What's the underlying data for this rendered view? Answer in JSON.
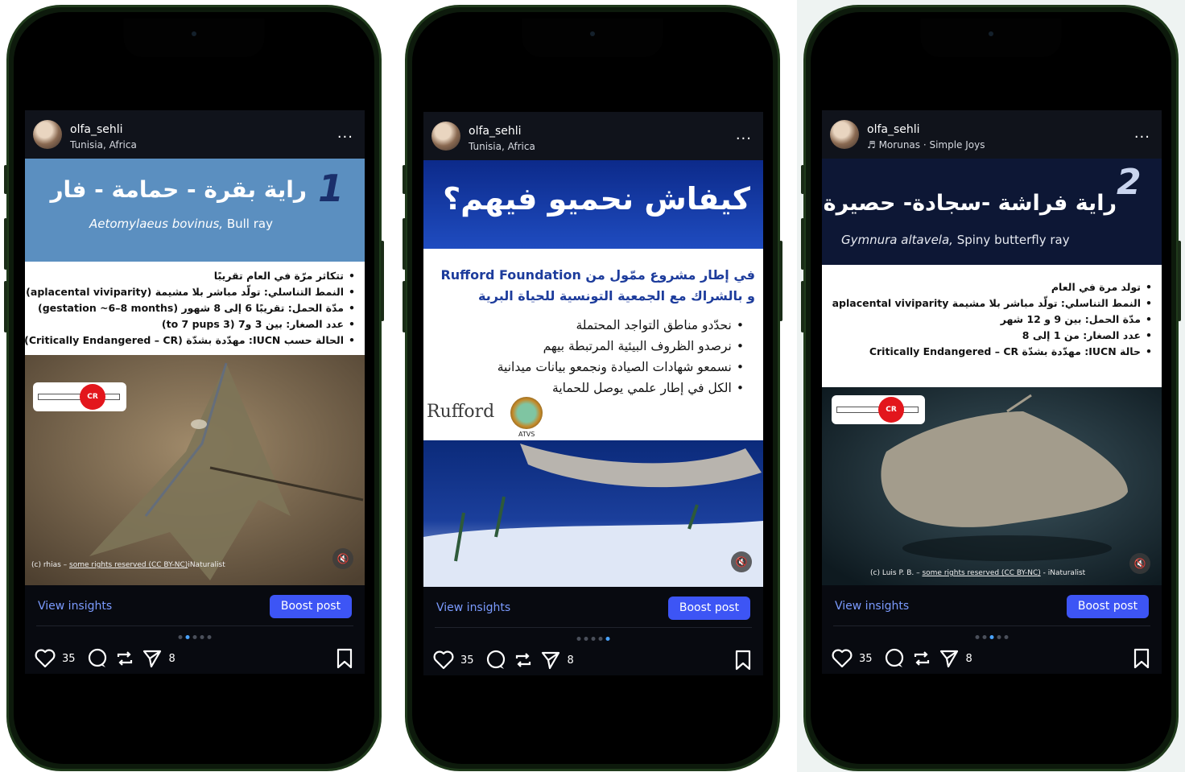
{
  "common": {
    "username": "olfa_sehli",
    "view_insights": "View insights",
    "boost_post": "Boost post",
    "likes": "35",
    "shares": "8",
    "more": "..."
  },
  "posts": [
    {
      "subtitle": "Tunisia, Africa",
      "number": "1",
      "title_ar": "راية بقرة - حمامة - فار",
      "sci_name": "Aetomylaeus bovinus,",
      "common_name": "Bull ray",
      "facts": [
        "تتكاثر مرّة في العام تقريبًا",
        "النمط التناسلي: تولّد مباشر بلا مشيمة (aplacental viviparity)",
        "مدّة الحمل: تقريبًا 6 إلى 8 شهور (gestation ~6–8 months)",
        "عدد الصغار: بين 3 و7 (3 to 7 pups)",
        "الحالة حسب IUCN: مهدّدة بشدّة (Critically Endangered – CR)"
      ],
      "badge": "CR",
      "credit_prefix": "(c) rhias –",
      "credit_link": "some rights reserved (CC BY-NC)",
      "credit_suffix": "iNaturalist",
      "page_index": 1,
      "page_count": 5
    },
    {
      "subtitle": "Tunisia, Africa",
      "title_ar": "كيفاش نحميو فيهم؟",
      "intro_line1": "في إطار مشروع ممّول من Rufford Foundation",
      "intro_line2": "و بالشراك مع الجمعية التونسية للحياة البرية",
      "bullets": [
        "نحدّدو مناطق التواجد المحتملة",
        "نرصدو الظروف البيئية المرتبطة بيهم",
        "نسمعو شهادات الصيادة ونجمعو بيانات ميدانية",
        "الكل في إطار علمي يوصل للحماية"
      ],
      "logo_rufford": "Rufford",
      "logo_atvs": "ATVS",
      "page_index": 4,
      "page_count": 5
    },
    {
      "subtitle": "Morunas · Simple Joys",
      "number": "2",
      "title_ar": "راية فراشة -سجادة- حصيرة",
      "sci_name": "Gymnura altavela,",
      "common_name": "Spiny butterfly ray",
      "facts": [
        "تولد مرة في العام",
        "النمط التناسلي: تولّد مباشر بلا مشيمة aplacental viviparity",
        "مدّة الحمل: بين 9 و 12 شهر",
        "عدد الصغار: من 1 إلى 8",
        "حالة IUCN: مهدّدة بشدّة Critically Endangered – CR"
      ],
      "badge": "CR",
      "credit_prefix": "(c) Luis P. B. –",
      "credit_link": "some rights reserved (CC BY-NC)",
      "credit_suffix": "- iNaturalist",
      "page_index": 2,
      "page_count": 5
    }
  ],
  "colors": {
    "title_band_1": "#5b8fc0",
    "title_band_2": "#1d46b0",
    "title_band_3": "#0d1735",
    "boost": "#3d55f5",
    "insights": "#7b9bff",
    "badge_red": "#e3161c"
  },
  "icons": [
    "heart-icon",
    "comment-icon",
    "repost-icon",
    "send-icon",
    "bookmark-icon",
    "mute-icon",
    "more-icon"
  ]
}
